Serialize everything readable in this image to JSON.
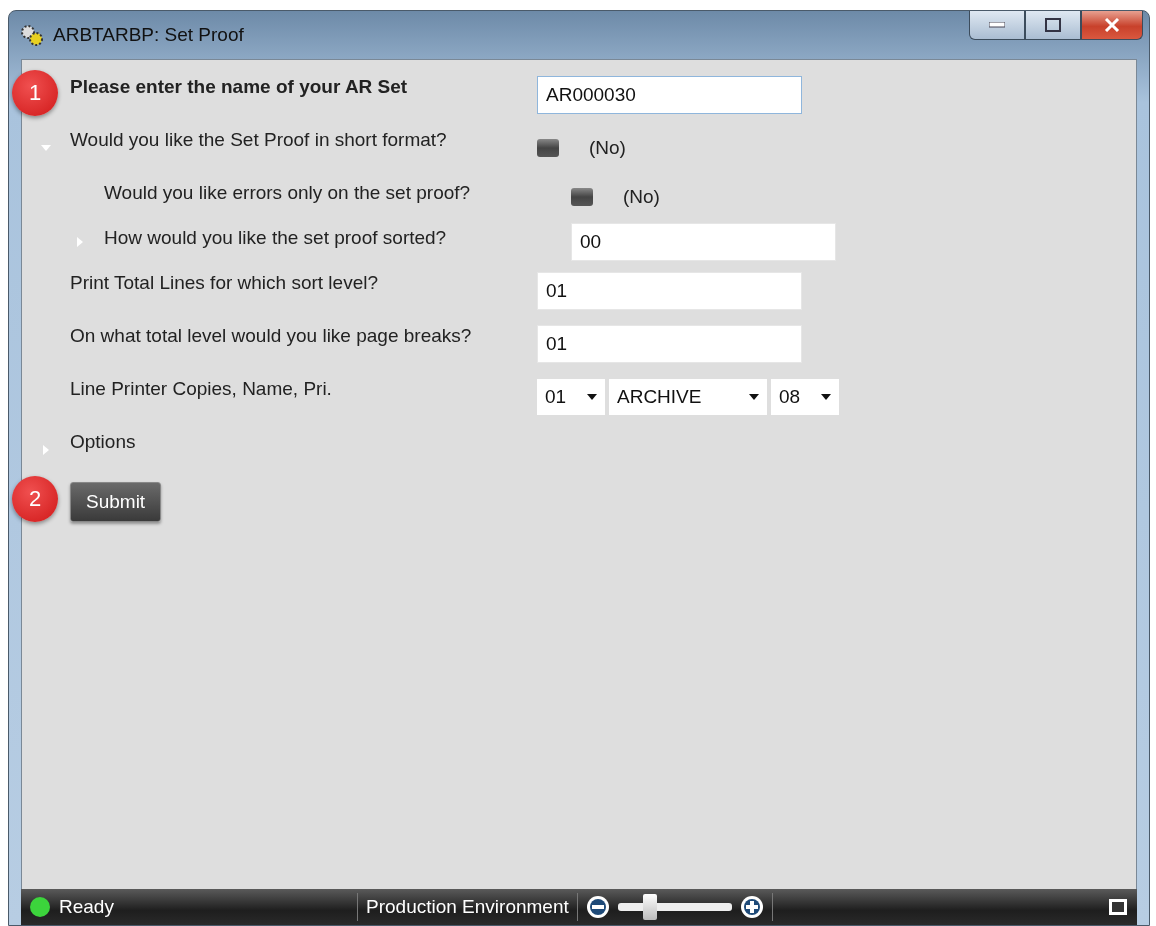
{
  "window": {
    "title": "ARBTARBP: Set Proof"
  },
  "rows": [
    {
      "kind": "text",
      "label": "Please enter the name of your AR Set",
      "bold": true,
      "badge": "1",
      "value": "AR000030",
      "focused": true
    },
    {
      "kind": "toggle",
      "label": "Would you like the Set Proof in short format?",
      "checked": false,
      "state_text": "(No)",
      "expanded": true,
      "children": [
        {
          "kind": "toggle",
          "label": "Would you like errors only on the set proof?",
          "checked": false,
          "state_text": "(No)"
        },
        {
          "kind": "text",
          "label": "How would you like the set proof sorted?",
          "value": "00",
          "expanded": false
        }
      ]
    },
    {
      "kind": "text",
      "label": "Print Total Lines for which sort level?",
      "value": "01"
    },
    {
      "kind": "text",
      "label": "On what total level would you like page breaks?",
      "value": "01"
    },
    {
      "kind": "dropdowns",
      "label": "Line Printer Copies, Name, Pri.",
      "values": [
        "01",
        "ARCHIVE",
        "08"
      ]
    },
    {
      "kind": "section",
      "label": "Options",
      "expanded": false
    }
  ],
  "submit": {
    "label": "Submit",
    "badge": "2"
  },
  "status_bar": {
    "status": "Ready",
    "environment": "Production Environment",
    "zoom": {
      "level": 0.28
    }
  }
}
